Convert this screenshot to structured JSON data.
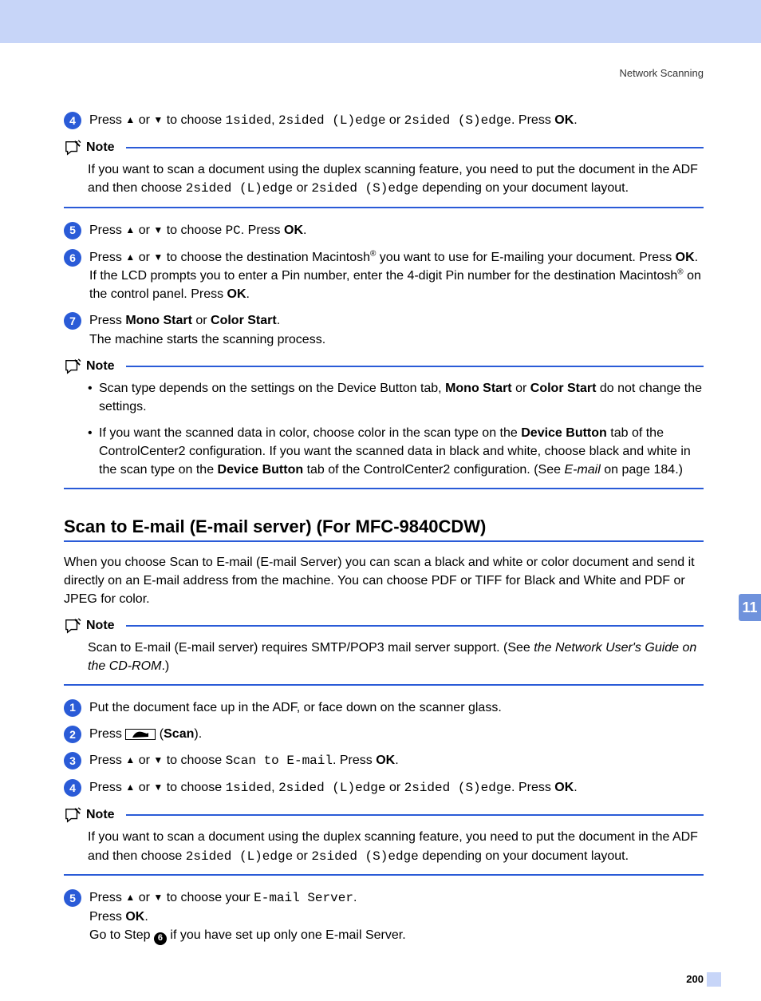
{
  "header": {
    "title": "Network Scanning"
  },
  "section_tab": "11",
  "page_number": "200",
  "labels": {
    "note": "Note",
    "ok": "OK",
    "press": "Press",
    "or": "or",
    "pc": "PC",
    "scan": "Scan",
    "mono_start": "Mono Start",
    "color_start": "Color Start",
    "device_button": "Device Button",
    "s1": "1sided",
    "s2l": "2sided (L)edge",
    "s2s": "2sided (S)edge",
    "scan_to_email": "Scan to E-mail",
    "email_server": "E-mail Server",
    "to_choose": "to choose",
    "pressb": ". Press"
  },
  "steps_a": {
    "s4a": "Press ",
    "s4b": " to choose ",
    "s4c": ". Press ",
    "s5a": "Press ",
    "s5c": ". Press ",
    "s6a": "Press ",
    "s6b": " to choose the destination Macintosh",
    "s6c": " you want to use for E-mailing your document. Press ",
    "s6d": "If the LCD prompts you to enter a Pin number, enter the 4-digit Pin number for the destination Macintosh",
    "s6e": " on the control panel.  Press ",
    "s7a": "Press ",
    "s7b": "The machine starts the scanning process."
  },
  "note1": "If you want to scan a document using the duplex scanning feature, you need to put the document in the ADF and then choose ",
  "note1b": " depending on your document layout.",
  "note2_b1a": "Scan type depends on the settings on the Device Button tab, ",
  "note2_b1b": " do not change the settings.",
  "note2_b2a": "If you want the scanned data in color, choose color in the scan type on the ",
  "note2_b2b": " tab of the ControlCenter2 configuration. If you want the scanned data in black and white, choose black and white in the scan type on the ",
  "note2_b2c": " tab of the ControlCenter2 configuration. (See ",
  "note2_b2d": "E-mail",
  "note2_b2e": " on page 184.)",
  "heading2": "Scan to E-mail (E-mail server) (For MFC-9840CDW)",
  "intro": "When you choose Scan to E-mail (E-mail Server) you can scan a black and white or color document and send it directly on an E-mail address from the machine. You can choose PDF or TIFF for Black and White and PDF or JPEG for color.",
  "note3a": "Scan to E-mail (E-mail server) requires SMTP/POP3 mail server support. (See ",
  "note3b": "the Network User's Guide on the CD-ROM",
  "note3c": ".)",
  "steps_b": {
    "s1": "Put the document face up in the ADF, or face down on the scanner glass.",
    "s2a": "Press ",
    "s2b": " (",
    "s2c": ").",
    "s3a": "Press ",
    "s3b": ". Press ",
    "s4a": "Press ",
    "s4b": ". Press ",
    "s5a": "Press ",
    "s5b": " to choose your ",
    "s5c": "Press ",
    "s5d": "Go to Step ",
    "s5e": " if you have set up only one E-mail Server."
  },
  "note4": "If you want to scan a document using the duplex scanning feature, you need to put the document in the ADF and then choose ",
  "note4b": " depending on your document layout."
}
